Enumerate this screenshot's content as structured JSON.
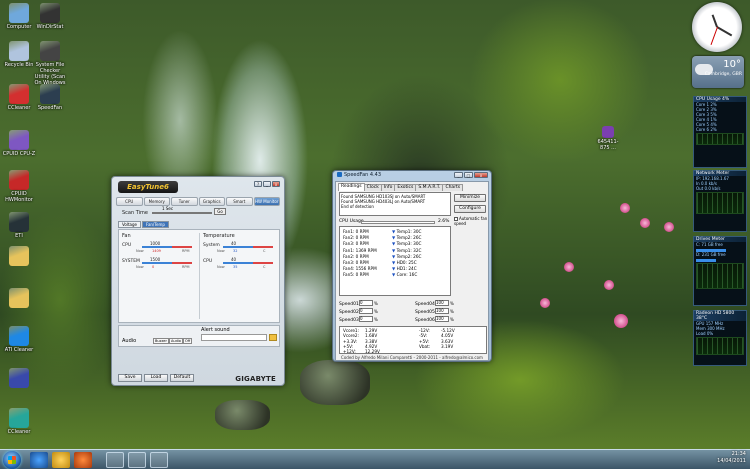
{
  "desktop": {
    "icons": [
      {
        "label": "Computer",
        "color": "#6fa8dc"
      },
      {
        "label": "WinDirStat",
        "color": "#333333"
      },
      {
        "label": "Recycle Bin",
        "color": "#b0c4de"
      },
      {
        "label": "System File Checker Utility (Scan On Windows",
        "color": "#444444"
      },
      {
        "label": "CCleaner",
        "color": "#d32f2f"
      },
      {
        "label": "SpeedFan",
        "color": "#2c3e50"
      },
      {
        "label": "CPUID CPU-Z",
        "color": "#7e57c2"
      },
      {
        "label": "CPUID HWMonitor",
        "color": "#c62828"
      },
      {
        "label": "ETI",
        "color": "#263238"
      },
      {
        "label": "",
        "color": "#e6c35c"
      },
      {
        "label": "",
        "color": "#e6c35c"
      },
      {
        "label": "ATI Cleaner",
        "color": "#1e88e5"
      },
      {
        "label": "",
        "color": "#3949ab"
      },
      {
        "label": "CCleaner",
        "color": "#26a69a"
      }
    ],
    "misc_icon_label": "645411-875 ...",
    "misc_icon_color": "#7b3fb0"
  },
  "gadgets": {
    "weather": {
      "temp": "10°",
      "location": "Cambridge, GBR"
    },
    "cpu_meter": {
      "title": "CPU Usage",
      "value": "4%",
      "rows": [
        "Core 1 2%",
        "Core 2 3%",
        "Core 3 5%",
        "Core 4 1%",
        "Core 5 4%",
        "Core 6 2%"
      ]
    },
    "network_meter": {
      "title": "Network Meter",
      "rows": [
        "IP: 192.168.1.67",
        "In 0.0 kb/s",
        "Out 0.0 kb/s"
      ]
    },
    "drives_meter": {
      "title": "Drives Meter",
      "rows": [
        "C: 71 GB free",
        "D: 231 GB free"
      ]
    },
    "gpu_meter": {
      "title": "Radeon HD 5800",
      "temp": "38°C",
      "rows": [
        "GPU 157 MHz",
        "Mem 300 MHz",
        "Load 0%"
      ]
    }
  },
  "easytune": {
    "logo": "EasyTune6",
    "tabs": [
      "CPU",
      "Memory",
      "Tuner",
      "Graphics",
      "Smart",
      "HW Monitor"
    ],
    "active_tab": "HW Monitor",
    "scan_time_label": "Scan Time",
    "scan_time_value": "1 Sec",
    "go_label": "Go",
    "subtabs": [
      "Voltage",
      "Fan/Temp"
    ],
    "fan_title": "Fan",
    "temp_title": "Temperature",
    "fans": [
      {
        "name": "CPU",
        "now": "1409",
        "limit": "1000",
        "unit": "RPM"
      },
      {
        "name": "SYSTEM",
        "now": "0",
        "limit": "1500",
        "unit": "RPM"
      }
    ],
    "temps": [
      {
        "name": "System",
        "now": "32",
        "limit": "40",
        "unit": "C"
      },
      {
        "name": "CPU",
        "now": "35",
        "limit": "40",
        "unit": "C"
      }
    ],
    "now_label": "Now",
    "audio_label": "Audio",
    "alert_sound_label": "Alert sound",
    "audio_buttons": [
      "Buzzer",
      "Audio",
      "Off"
    ],
    "bottom_buttons": [
      "Save",
      "Load",
      "Default"
    ],
    "brand": "GIGABYTE",
    "win_controls": [
      "?",
      "_",
      "x"
    ]
  },
  "speedfan": {
    "title": "SpeedFan 4.43",
    "tabs": [
      "Readings",
      "Clock",
      "Info",
      "Exotics",
      "S.M.A.R.T.",
      "Charts"
    ],
    "active_tab": "Readings",
    "log_lines": [
      "Found SAMSUNG HD103SJ on Auto/SMART",
      "Found SAMSUNG HD403LJ on Auto/SMART",
      "End of detection"
    ],
    "minimize_label": "Minimize",
    "configure_label": "Configure",
    "auto_fan_label": "Automatic fan speed",
    "cpu_usage_label": "CPU Usage",
    "cpu_usage_value": "2.6%",
    "fans": [
      "Fan1: 0 RPM",
      "Fan2: 0 RPM",
      "Fan3: 0 RPM",
      "Fan1: 1369 RPM",
      "Fan2: 0 RPM",
      "Fan3: 0 RPM",
      "Fan4: 1556 RPM",
      "Fan5: 0 RPM"
    ],
    "temps": [
      {
        "label": "Temp1:",
        "value": "30C"
      },
      {
        "label": "Temp2:",
        "value": "26C"
      },
      {
        "label": "Temp3:",
        "value": "30C"
      },
      {
        "label": "Temp1:",
        "value": "32C"
      },
      {
        "label": "Temp2:",
        "value": "26C"
      },
      {
        "label": "HD0:",
        "value": "25C"
      },
      {
        "label": "HD1:",
        "value": "24C"
      },
      {
        "label": "Core:",
        "value": "16C"
      }
    ],
    "speeds": [
      {
        "label": "Speed01:",
        "value": "0"
      },
      {
        "label": "Speed02:",
        "value": "0"
      },
      {
        "label": "Speed03:",
        "value": "0"
      },
      {
        "label": "Speed04:",
        "value": "100"
      },
      {
        "label": "Speed05:",
        "value": "100"
      },
      {
        "label": "Speed06:",
        "value": "100"
      }
    ],
    "pct": "%",
    "volts": [
      [
        "Vcore1:",
        "1.29V"
      ],
      [
        "Vcore2:",
        "1.68V"
      ],
      [
        "+3.3V:",
        "3.38V"
      ],
      [
        "+5V:",
        "4.92V"
      ],
      [
        "+12V:",
        "12.29V"
      ],
      [
        "-12V:",
        "-5.12V"
      ],
      [
        "-5V:",
        "4.05V"
      ],
      [
        "+5V:",
        "3.63V"
      ],
      [
        "Vbat:",
        "3.19V"
      ]
    ],
    "footer": "Coded by Alfredo Milani Comparetti - 2000-2011 - alfredo@almico.com"
  },
  "taskbar": {
    "time": "21:34",
    "date": "14/04/2011"
  }
}
